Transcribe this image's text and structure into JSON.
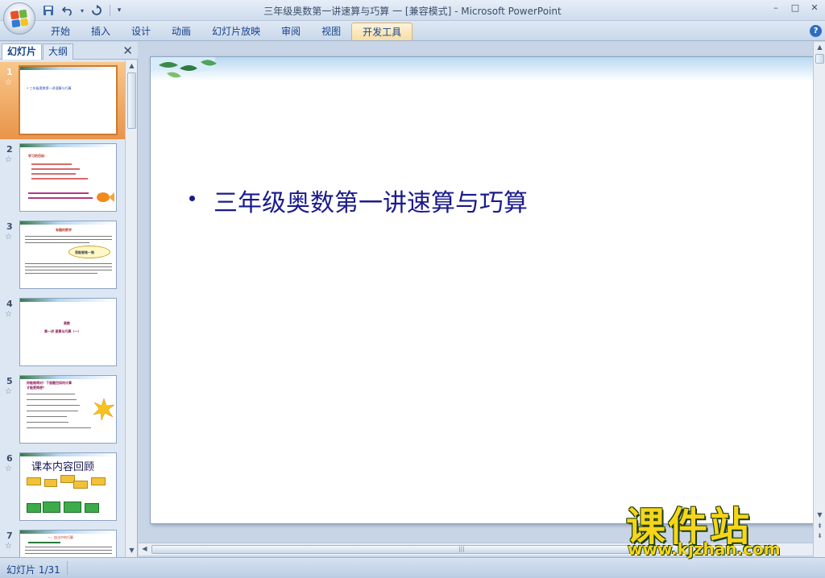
{
  "window": {
    "title": "三年级奥数第一讲速算与巧算 一 [兼容模式] - Microsoft PowerPoint",
    "controls": [
      "–",
      "□",
      "✕"
    ]
  },
  "qat": {
    "save_icon": "save-icon",
    "undo_icon": "undo-icon",
    "redo_icon": "redo-icon",
    "customize_icon": "customize-icon"
  },
  "ribbon": {
    "tabs": [
      "开始",
      "插入",
      "设计",
      "动画",
      "幻灯片放映",
      "审阅",
      "视图",
      "开发工具"
    ],
    "active_tab": "开发工具",
    "help": "?"
  },
  "pane": {
    "tab_slides": "幻灯片",
    "tab_outline": "大纲",
    "close": "✕"
  },
  "thumbnails": [
    {
      "num": "1",
      "star": "☆",
      "texts": [
        "• 三年级奥数第一讲速算与巧算"
      ]
    },
    {
      "num": "2",
      "star": "☆",
      "texts": [
        "学习的目标："
      ]
    },
    {
      "num": "3",
      "star": "☆",
      "texts": [
        "有趣的数学",
        "我能够推一推"
      ]
    },
    {
      "num": "4",
      "star": "☆",
      "texts": [
        "奥数",
        "第一讲 速算与巧算（一）"
      ]
    },
    {
      "num": "5",
      "star": "☆",
      "texts": [
        "你能做得对！下面题目如何计算",
        "才能更简便？"
      ]
    },
    {
      "num": "6",
      "star": "☆",
      "texts": [
        "课本内容回顾"
      ]
    },
    {
      "num": "7",
      "star": "☆",
      "texts": [
        "一、加法中的巧算"
      ]
    }
  ],
  "slide": {
    "bullet_text": "三年级奥数第一讲速算与巧算"
  },
  "status": {
    "slide_counter": "幻灯片 1/31"
  },
  "watermark": {
    "big": "课件站",
    "url": "www.kjzhan.com"
  },
  "colors": {
    "accent": "#15428b",
    "slide_text": "#1a1a8c",
    "selected_thumb": "#e9944a",
    "watermark": "#f6d51a"
  }
}
